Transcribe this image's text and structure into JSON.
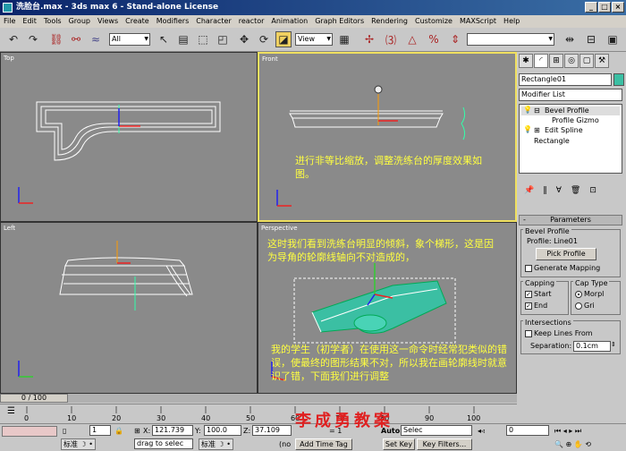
{
  "window": {
    "title": "洗脸台.max - 3ds max 6 - Stand-alone License"
  },
  "menu": [
    "File",
    "Edit",
    "Tools",
    "Group",
    "Views",
    "Create",
    "Modifiers",
    "Character",
    "reactor",
    "Animation",
    "Graph Editors",
    "Rendering",
    "Customize",
    "MAXScript",
    "Help"
  ],
  "toolbar": {
    "selection_filter": "All",
    "ref_coord": "View"
  },
  "viewports": {
    "top": "Top",
    "front": "Front",
    "left": "Left",
    "perspective": "Perspective"
  },
  "captions": {
    "front": "进行非等比缩放，调整洗练台的厚度效果如图。",
    "perspective_top": "这时我们看到洗练台明显的倾斜，象个梯形，这是因为导角的轮廓线轴向不对造成的，",
    "perspective_bottom": "我的学生（初学者）在使用这一命令时经常犯类似的错误，使最终的图形结果不对，所以我在画轮廓线时就意识了错，下面我们进行调整"
  },
  "command_panel": {
    "object_name": "Rectangle01",
    "modifier_list": "Modifier List",
    "stack": {
      "bevel_profile": "Bevel Profile",
      "profile_gizmo": "Profile Gizmo",
      "edit_spline": "Edit Spline",
      "rectangle": "Rectangle"
    },
    "parameters": {
      "title": "Parameters",
      "group_bevel_profile": "Bevel Profile",
      "profile_label": "Profile:",
      "profile_value": "Line01",
      "pick_profile": "Pick Profile",
      "generate_mapping": "Generate Mapping",
      "capping": "Capping",
      "start": "Start",
      "end": "End",
      "cap_type": "Cap Type",
      "morph": "Morpl",
      "grid": "Gri",
      "intersections": "Intersections",
      "keep_lines_from": "Keep Lines From",
      "separation_label": "Separation:",
      "separation_value": "0.1cm"
    }
  },
  "timeline": {
    "frame_range": "0 / 100",
    "ticks": [
      "0",
      "10",
      "20",
      "30",
      "40",
      "50",
      "60",
      "70",
      "80",
      "90",
      "100"
    ]
  },
  "status": {
    "count": "1",
    "x_label": "X:",
    "x_value": "121.739",
    "y_label": "Y:",
    "y_value": "100.0",
    "z_label": "Z:",
    "z_value": "37.109",
    "grid_text": "= 1",
    "lang1": "标准",
    "lang2": "标准",
    "prompt": "drag to selec",
    "add_time_tag": "Add Time Tag",
    "set_key": "Set Key",
    "key_filters": "Key Filters...",
    "auto_key": "Auto",
    "selected": "Selec",
    "frame": "0",
    "prefix": "(no"
  },
  "watermark": "李成勇教案"
}
